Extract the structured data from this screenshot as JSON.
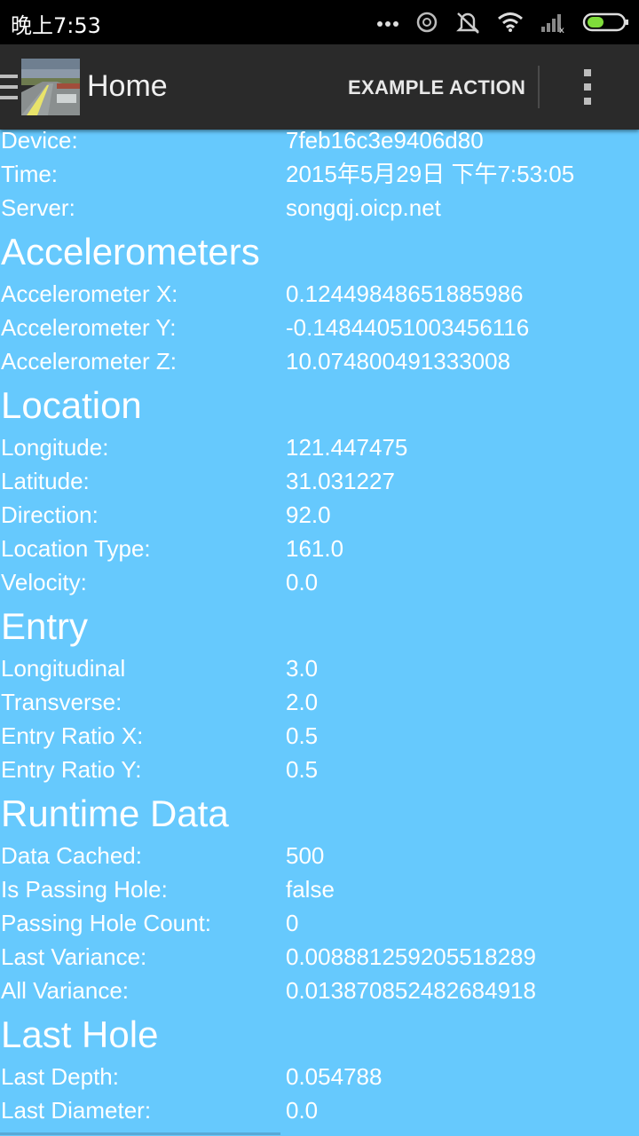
{
  "status_bar": {
    "time": "晚上7:53",
    "icons": [
      "more-dots-icon",
      "sync-icon",
      "silent-icon",
      "wifi-icon",
      "signal-icon",
      "battery-icon"
    ]
  },
  "action_bar": {
    "title": "Home",
    "action": "EXAMPLE ACTION",
    "colors": {
      "background": "#2a2a2a",
      "text": "#f0f0f0"
    }
  },
  "content": {
    "background": "#66c9fd",
    "device": {
      "label": "Device:",
      "value": "7feb16c3e9406d80"
    },
    "time": {
      "label": "Time:",
      "value": "2015年5月29日 下午7:53:05"
    },
    "server": {
      "label": "Server:",
      "value": "songqj.oicp.net"
    },
    "accelerometers": {
      "heading": "Accelerometers",
      "x": {
        "label": "Accelerometer X:",
        "value": "0.12449848651885986"
      },
      "y": {
        "label": "Accelerometer Y:",
        "value": "-0.14844051003456116"
      },
      "z": {
        "label": "Accelerometer Z:",
        "value": "10.074800491333008"
      }
    },
    "location": {
      "heading": "Location",
      "longitude": {
        "label": "Longitude:",
        "value": "121.447475"
      },
      "latitude": {
        "label": "Latitude:",
        "value": "31.031227"
      },
      "direction": {
        "label": "Direction:",
        "value": "92.0"
      },
      "location_type": {
        "label": "Location Type:",
        "value": "161.0"
      },
      "velocity": {
        "label": "Velocity:",
        "value": "0.0"
      }
    },
    "entry": {
      "heading": "Entry",
      "longitudinal": {
        "label": "Longitudinal",
        "value": "3.0"
      },
      "transverse": {
        "label": "Transverse:",
        "value": "2.0"
      },
      "ratio_x": {
        "label": "Entry Ratio X:",
        "value": "0.5"
      },
      "ratio_y": {
        "label": "Entry Ratio Y:",
        "value": "0.5"
      }
    },
    "runtime": {
      "heading": "Runtime Data",
      "data_cached": {
        "label": "Data Cached:",
        "value": "500"
      },
      "is_passing_hole": {
        "label": "Is Passing Hole:",
        "value": "false"
      },
      "passing_hole_count": {
        "label": "Passing Hole Count:",
        "value": "0"
      },
      "last_variance": {
        "label": "Last Variance:",
        "value": "0.008881259205518289"
      },
      "all_variance": {
        "label": "All Variance:",
        "value": "0.013870852482684918"
      }
    },
    "last_hole": {
      "heading": "Last Hole",
      "last_depth": {
        "label": "Last Depth:",
        "value": "0.054788"
      },
      "last_diameter": {
        "label": "Last Diameter:",
        "value": "0.0"
      }
    }
  }
}
